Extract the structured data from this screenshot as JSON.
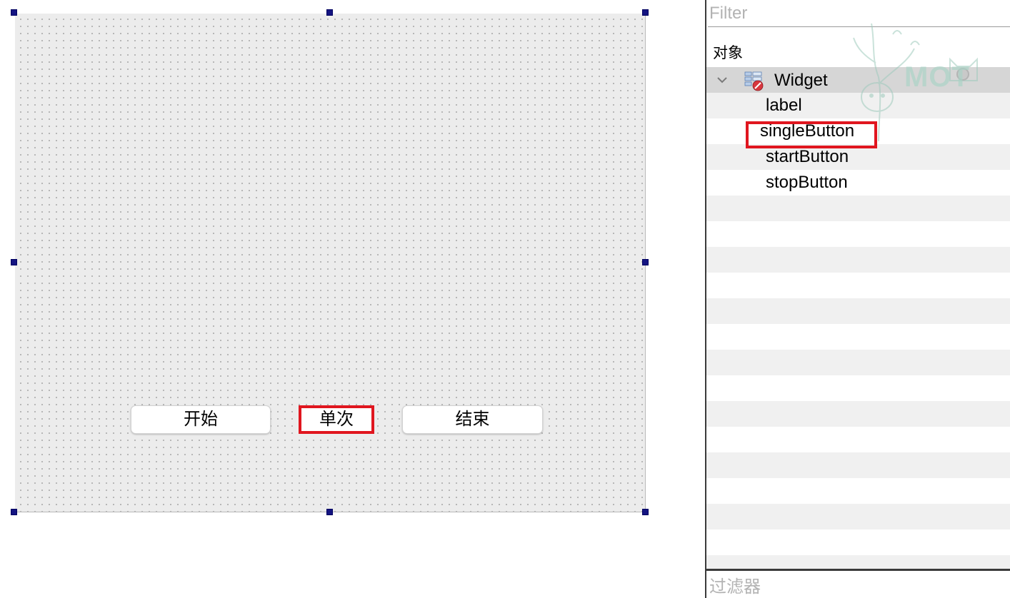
{
  "form": {
    "buttons": [
      {
        "label": "开始",
        "name": "startButton"
      },
      {
        "label": "单次",
        "name": "singleButton"
      },
      {
        "label": "结束",
        "name": "stopButton"
      }
    ]
  },
  "object_inspector": {
    "filter_placeholder": "Filter",
    "column_header": "对象",
    "root": {
      "label": "Widget",
      "icon": "widget-icon",
      "expanded": true
    },
    "children": [
      {
        "label": "label"
      },
      {
        "label": "singleButton"
      },
      {
        "label": "startButton"
      },
      {
        "label": "stopButton"
      }
    ],
    "highlighted_item": "singleButton"
  },
  "bottom_filter": {
    "placeholder": "过滤器"
  },
  "watermark": {
    "text": "MOT",
    "icon": "tree-character-logo"
  },
  "colors": {
    "highlight": "#e0161f",
    "handle": "#141481",
    "selected_row": "#d6d6d6",
    "alt_row": "#f0f0f0"
  }
}
